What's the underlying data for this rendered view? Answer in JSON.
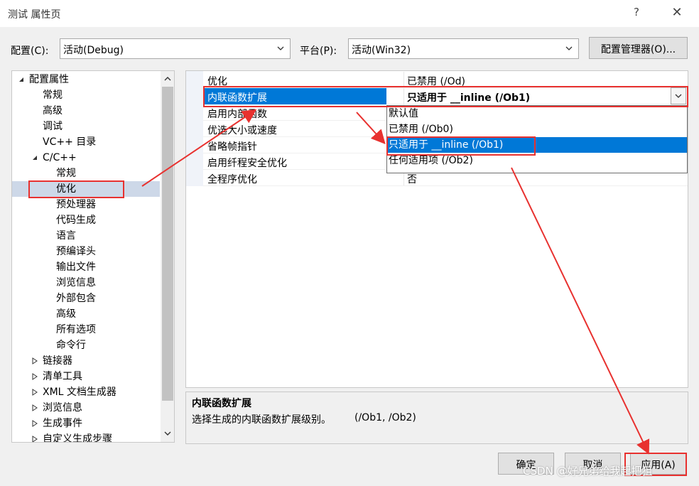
{
  "window": {
    "title": "测试 属性页",
    "help_label": "?",
    "close_label": "✕"
  },
  "toolbar": {
    "config_label": "配置(C):",
    "config_value": "活动(Debug)",
    "platform_label": "平台(P):",
    "platform_value": "活动(Win32)",
    "config_manager_label": "配置管理器(O)..."
  },
  "tree": {
    "items": [
      {
        "label": "配置属性",
        "expanded": true
      },
      {
        "label": "常规"
      },
      {
        "label": "高级"
      },
      {
        "label": "调试"
      },
      {
        "label": "VC++ 目录"
      },
      {
        "label": "C/C++",
        "expanded": true
      },
      {
        "label": "常规"
      },
      {
        "label": "优化",
        "selected": true
      },
      {
        "label": "预处理器"
      },
      {
        "label": "代码生成"
      },
      {
        "label": "语言"
      },
      {
        "label": "预编译头"
      },
      {
        "label": "输出文件"
      },
      {
        "label": "浏览信息"
      },
      {
        "label": "外部包含"
      },
      {
        "label": "高级"
      },
      {
        "label": "所有选项"
      },
      {
        "label": "命令行"
      },
      {
        "label": "链接器",
        "expanded": false
      },
      {
        "label": "清单工具",
        "expanded": false
      },
      {
        "label": "XML 文档生成器",
        "expanded": false
      },
      {
        "label": "浏览信息",
        "expanded": false
      },
      {
        "label": "生成事件",
        "expanded": false
      },
      {
        "label": "自定义生成步骤",
        "expanded": false
      }
    ]
  },
  "grid": {
    "rows": [
      {
        "name": "优化",
        "value": "已禁用 (/Od)"
      },
      {
        "name": "内联函数扩展",
        "value": "只适用于 __inline (/Ob1)",
        "selected": true
      },
      {
        "name": "启用内部函数",
        "value": ""
      },
      {
        "name": "优选大小或速度",
        "value": ""
      },
      {
        "name": "省略帧指针",
        "value": ""
      },
      {
        "name": "启用纤程安全优化",
        "value": ""
      },
      {
        "name": "全程序优化",
        "value": "否"
      }
    ],
    "dropdown_options": [
      "默认值",
      "已禁用 (/Ob0)",
      "只适用于 __inline (/Ob1)",
      "任何适用项 (/Ob2)"
    ],
    "dropdown_highlighted": "只适用于 __inline (/Ob1)"
  },
  "description": {
    "title": "内联函数扩展",
    "text": "选择生成的内联函数扩展级别。",
    "hint": "(/Ob1, /Ob2)"
  },
  "buttons": {
    "ok": "确定",
    "cancel": "取消",
    "apply": "应用(A)"
  },
  "watermark": "CSDN @好兄弟给我起把狙",
  "colors": {
    "selection": "#0078d7",
    "annotation": "#e8312f"
  }
}
